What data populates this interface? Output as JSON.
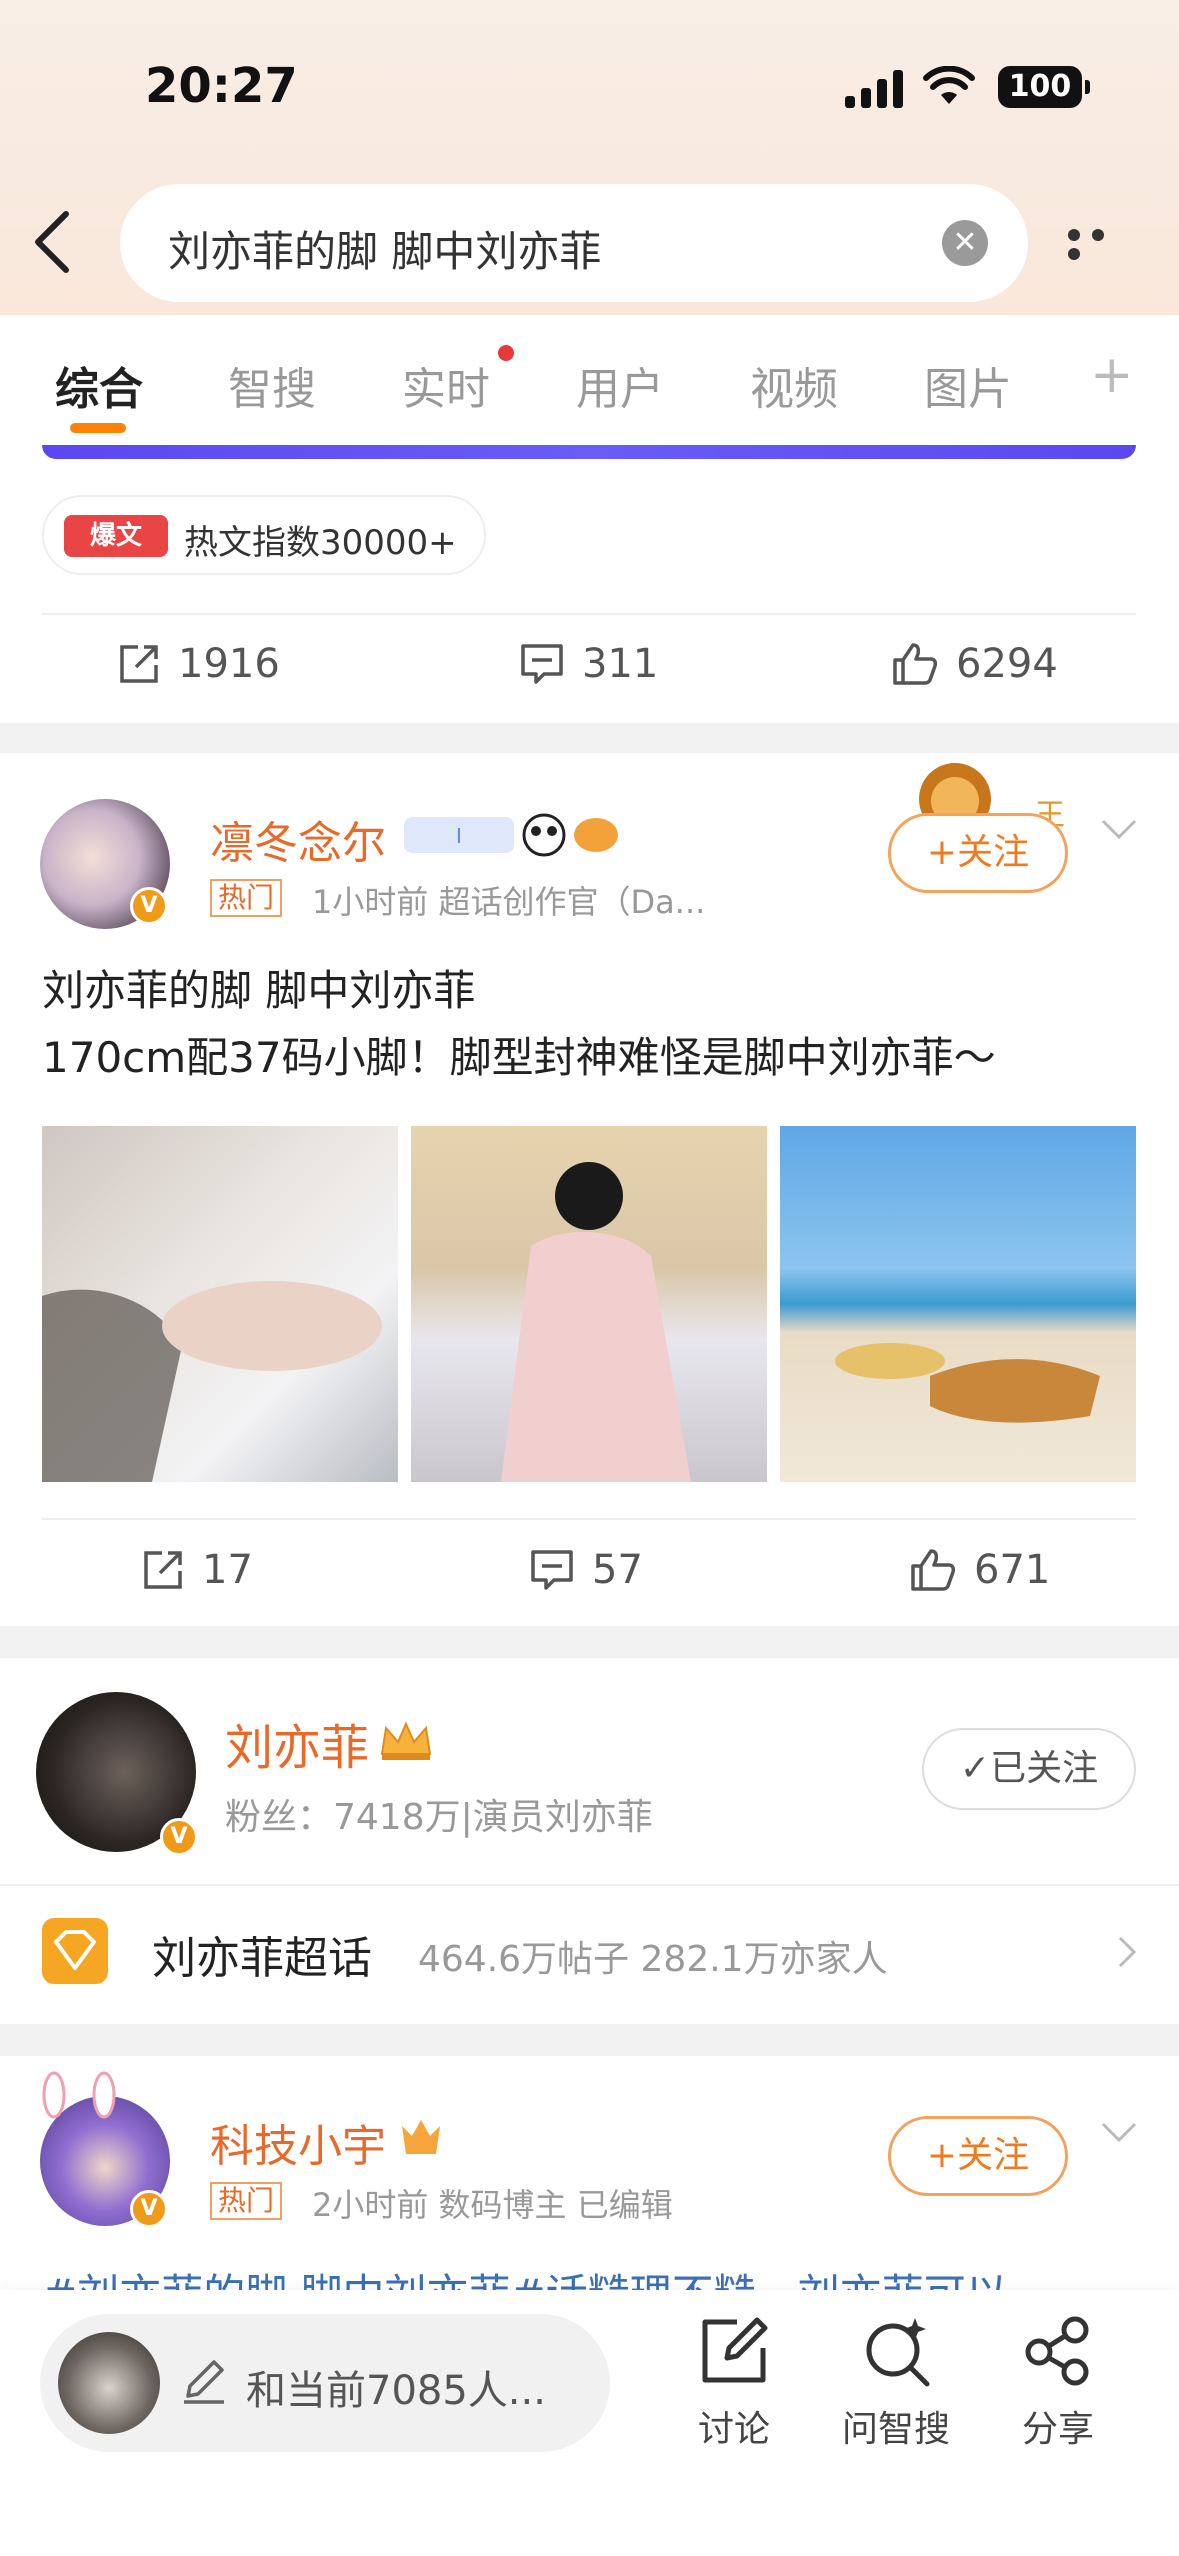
{
  "status_bar": {
    "time": "20:27",
    "battery": "100"
  },
  "search": {
    "query": "刘亦菲的脚 脚中刘亦菲"
  },
  "tabs": [
    {
      "label": "综合",
      "active": true
    },
    {
      "label": "智搜"
    },
    {
      "label": "实时",
      "has_dot": true
    },
    {
      "label": "用户"
    },
    {
      "label": "视频"
    },
    {
      "label": "图片"
    }
  ],
  "tab_plus": "+",
  "card1": {
    "hot_tag": "爆文",
    "hot_text": "热文指数30000+",
    "reposts": "1916",
    "comments": "311",
    "likes": "6294"
  },
  "post1": {
    "username": "凛冬念尔",
    "hot_label": "热门",
    "meta": "1小时前  超话创作官（Da...",
    "follow_label": "+关注",
    "text_line1": "刘亦菲的脚 脚中刘亦菲",
    "text_line2": "170cm配37码小脚！脚型封神难怪是脚中刘亦菲～",
    "reposts": "17",
    "comments": "57",
    "likes": "671"
  },
  "actor": {
    "name": "刘亦菲",
    "meta": "粉丝：7418万|演员刘亦菲",
    "followed_label": "✓已关注",
    "super_name": "刘亦菲超话",
    "super_stats": "464.6万帖子  282.1万亦家人"
  },
  "post2": {
    "username": "科技小宇",
    "hot_label": "热门",
    "meta": "2小时前  数码博主  已编辑",
    "follow_label": "+关注",
    "text_peek": "#刘亦菲的脚 脚中刘亦菲#话糙理不糙，刘亦菲可以"
  },
  "bottom_bar": {
    "comment_placeholder": "和当前7085人...",
    "discuss": "讨论",
    "ask": "问智搜",
    "share": "分享"
  },
  "colors": {
    "accent": "#ff8200",
    "username": "#e86a2a",
    "hot_red": "#ea4545"
  }
}
